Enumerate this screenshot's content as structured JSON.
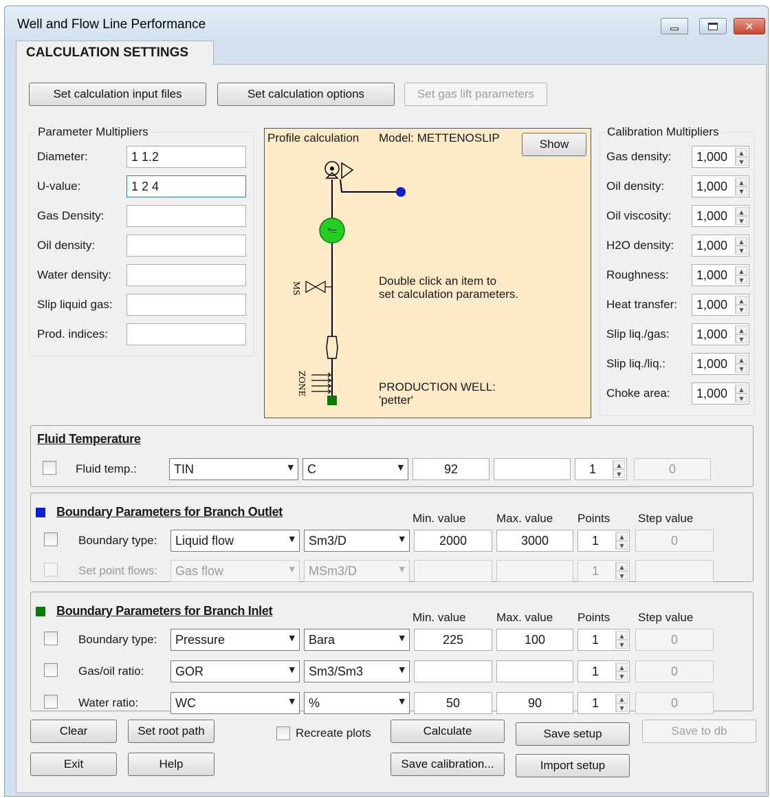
{
  "window": {
    "title": "Well and Flow Line  Performance"
  },
  "tab": {
    "label": "CALCULATION SETTINGS"
  },
  "top_buttons": {
    "input_files": "Set calculation input files",
    "options": "Set calculation options",
    "gas_lift": "Set gas lift parameters"
  },
  "param_multipliers": {
    "title": "Parameter Multipliers",
    "rows": [
      {
        "label": "Diameter:",
        "value": "1 1.2"
      },
      {
        "label": "U-value:",
        "value": "1 2 4"
      },
      {
        "label": "Gas Density:",
        "value": ""
      },
      {
        "label": "Oil density:",
        "value": ""
      },
      {
        "label": "Water density:",
        "value": ""
      },
      {
        "label": "Slip liquid gas:",
        "value": ""
      },
      {
        "label": "Prod. indices:",
        "value": ""
      }
    ]
  },
  "profile": {
    "title": "Profile calculation",
    "model": "Model: METTENOSLIP",
    "show_button": "Show",
    "hint": "Double click an item to\nset calculation parameters.",
    "well_label": "PRODUCTION WELL:\n'petter'",
    "ms_label": "MS",
    "zone_label": "ZONE",
    "marker_text": "*="
  },
  "calibration": {
    "title": "Calibration Multipliers",
    "rows": [
      {
        "label": "Gas density:",
        "value": "1,000"
      },
      {
        "label": "Oil density:",
        "value": "1,000"
      },
      {
        "label": "Oil viscosity:",
        "value": "1,000"
      },
      {
        "label": "H2O density:",
        "value": "1,000"
      },
      {
        "label": "Roughness:",
        "value": "1,000"
      },
      {
        "label": "Heat transfer:",
        "value": "1,000"
      },
      {
        "label": "Slip liq./gas:",
        "value": "1,000"
      },
      {
        "label": "Slip liq./liq.:",
        "value": "1,000"
      },
      {
        "label": "Choke area:",
        "value": "1,000"
      }
    ]
  },
  "fluid_temp": {
    "title": "Fluid Temperature",
    "label": "Fluid temp.:",
    "type": "TIN",
    "unit": "C",
    "value": "92",
    "max": "",
    "points": "1",
    "step": "0"
  },
  "outlet": {
    "title": "Boundary Parameters for Branch Outlet",
    "marker_color": "#0a1fd8",
    "headers": {
      "min": "Min. value",
      "max": "Max. value",
      "points": "Points",
      "step": "Step value"
    },
    "rows": [
      {
        "label": "Boundary type:",
        "type": "Liquid flow",
        "unit": "Sm3/D",
        "min": "2000",
        "max": "3000",
        "points": "1",
        "step": "0"
      },
      {
        "label": "Set point flows:",
        "type": "Gas flow",
        "unit": "MSm3/D",
        "min": "",
        "max": "",
        "points": "1",
        "step": ""
      }
    ]
  },
  "inlet": {
    "title": "Boundary Parameters for Branch Inlet",
    "marker_color": "#0a7a0a",
    "headers": {
      "min": "Min. value",
      "max": "Max. value",
      "points": "Points",
      "step": "Step value"
    },
    "rows": [
      {
        "label": "Boundary type:",
        "type": "Pressure",
        "unit": "Bara",
        "min": "225",
        "max": "100",
        "points": "1",
        "step": "0"
      },
      {
        "label": "Gas/oil ratio:",
        "type": "GOR",
        "unit": "Sm3/Sm3",
        "min": "",
        "max": "",
        "points": "1",
        "step": "0"
      },
      {
        "label": "Water ratio:",
        "type": "WC",
        "unit": "%",
        "min": "50",
        "max": "90",
        "points": "1",
        "step": "0"
      }
    ]
  },
  "bottom_buttons": {
    "clear": "Clear",
    "set_root": "Set root path",
    "recreate": "Recreate plots",
    "calculate": "Calculate",
    "save_setup": "Save setup",
    "save_db": "Save to db",
    "exit": "Exit",
    "help": "Help",
    "save_calibration": "Save calibration...",
    "import_setup": "Import setup"
  }
}
